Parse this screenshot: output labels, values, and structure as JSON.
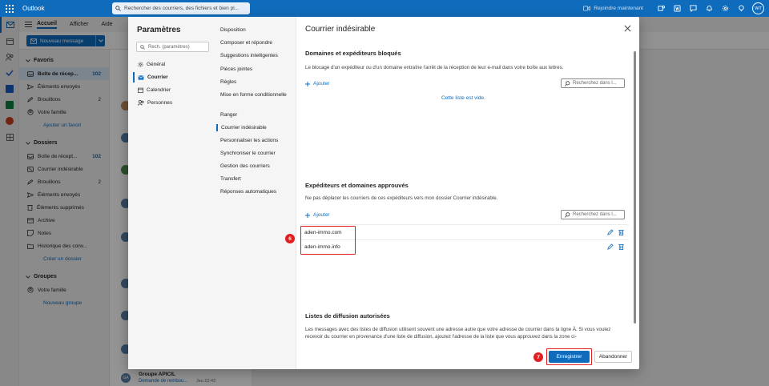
{
  "app": {
    "name": "Outlook"
  },
  "search": {
    "placeholder": "Rechercher des courriers, des fichiers et bien pl..."
  },
  "topbar": {
    "join_label": "Rejoindre maintenant",
    "avatar_initials": "WT"
  },
  "ribbon": {
    "tabs": [
      "Accueil",
      "Afficher",
      "Aide"
    ],
    "new_message": "Nouveau message"
  },
  "folders": {
    "favorites_label": "Favoris",
    "favorites": [
      {
        "label": "Boîte de récep...",
        "count": "102",
        "selected": true
      },
      {
        "label": "Éléments envoyés",
        "count": ""
      },
      {
        "label": "Brouillons",
        "count": "2"
      },
      {
        "label": "Votre famille",
        "count": ""
      }
    ],
    "add_favorite": "Ajouter un favori",
    "folders_label": "Dossiers",
    "items": [
      {
        "label": "Boîte de récept...",
        "count": "102"
      },
      {
        "label": "Courrier indésirable",
        "count": ""
      },
      {
        "label": "Brouillons",
        "count": "2"
      },
      {
        "label": "Éléments envoyés",
        "count": ""
      },
      {
        "label": "Éléments supprimés",
        "count": ""
      },
      {
        "label": "Archive",
        "count": ""
      },
      {
        "label": "Notes",
        "count": ""
      },
      {
        "label": "Historique des conv...",
        "count": ""
      }
    ],
    "create_folder": "Créer un dossier",
    "groups_label": "Groupes",
    "groups": [
      {
        "label": "Votre famille"
      }
    ],
    "new_group": "Nouveau groupe"
  },
  "message_list": {
    "last": {
      "from": "Groupe APICIL",
      "subject": "Demande de rembou...",
      "time": "Jeu 22:42",
      "initials": "GA"
    }
  },
  "settings": {
    "title": "Paramètres",
    "search_placeholder": "Rech. (paramètres)",
    "categories": [
      {
        "label": "Général",
        "icon": "gear-icon"
      },
      {
        "label": "Courrier",
        "icon": "mail-icon",
        "selected": true
      },
      {
        "label": "Calendrier",
        "icon": "calendar-icon"
      },
      {
        "label": "Personnes",
        "icon": "people-icon"
      }
    ],
    "subnav": [
      "Disposition",
      "Composer et répondre",
      "Suggestions intelligentes",
      "Pièces jointes",
      "Règles",
      "Mise en forme conditionnelle",
      "Ranger",
      "Courrier indésirable",
      "Personnaliser les actions",
      "Synchroniser le courrier",
      "Gestion des courriers",
      "Transfert",
      "Réponses automatiques"
    ],
    "subnav_selected": "Courrier indésirable"
  },
  "junk": {
    "title": "Courrier indésirable",
    "blocked": {
      "heading": "Domaines et expéditeurs bloqués",
      "description": "Le blocage d'un expéditeur ou d'un domaine entraîne l'arrêt de la réception de leur e-mail dans votre boîte aux lettres.",
      "add_label": "Ajouter",
      "search_placeholder": "Recherchez dans l...",
      "empty_text": "Cette liste est vide."
    },
    "safe": {
      "heading": "Expéditeurs et domaines approuvés",
      "description": "Ne pas déplacer les courriers de ces expéditeurs vers mon dossier Courrier indésirable.",
      "add_label": "Ajouter",
      "search_placeholder": "Recherchez dans l...",
      "entries": [
        "aden-immo.com",
        "aden-immo.info"
      ]
    },
    "mailing": {
      "heading": "Listes de diffusion autorisées",
      "description": "Les messages avec des listes de diffusion utilisent souvent une adresse autre que votre adresse de courrier dans la ligne À. Si vous voulez recevoir du courrier en provenance d'une liste de diffusion, ajoutez l'adresse de la liste que vous approuvez dans la zone ci-"
    },
    "save_label": "Enregistrer",
    "cancel_label": "Abandonner"
  },
  "annotations": {
    "step_entries": "6",
    "step_save": "7",
    "color": "#e02020"
  }
}
